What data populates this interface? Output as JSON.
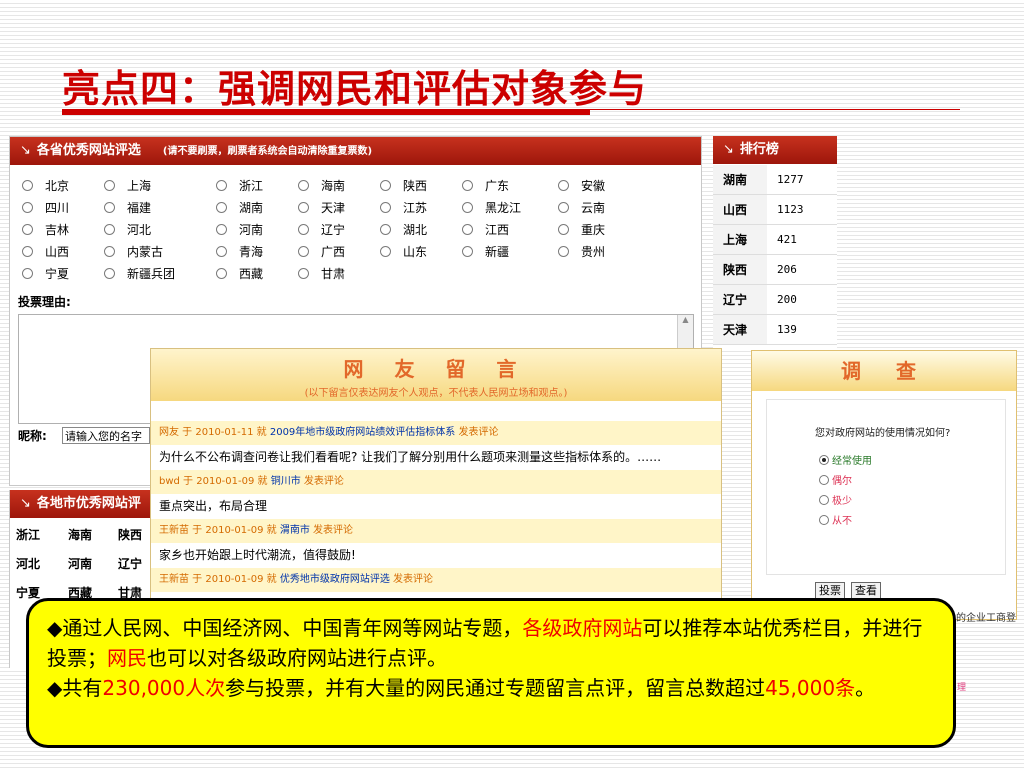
{
  "slide": {
    "title": "亮点四：强调网民和评估对象参与"
  },
  "vote_panel": {
    "header": "各省优秀网站评选",
    "header_note": "(请不要刷票，刷票者系统会自动清除重复票数)",
    "provinces": [
      "北京",
      "上海",
      "浙江",
      "海南",
      "陕西",
      "广东",
      "安徽",
      "四川",
      "福建",
      "湖南",
      "天津",
      "江苏",
      "黑龙江",
      "云南",
      "吉林",
      "河北",
      "河南",
      "辽宁",
      "湖北",
      "江西",
      "重庆",
      "山西",
      "内蒙古",
      "青海",
      "广西",
      "山东",
      "新疆",
      "贵州",
      "宁夏",
      "新疆兵团",
      "西藏",
      "甘肃"
    ],
    "reason_label": "投票理由:",
    "nickname_label": "昵称:",
    "nickname_value": "请输入您的名字"
  },
  "city_panel": {
    "header": "各地市优秀网站评",
    "cities": [
      "浙江",
      "海南",
      "陕西",
      "河北",
      "河南",
      "辽宁",
      "宁夏",
      "西藏",
      "甘肃"
    ]
  },
  "ranking": {
    "header": "排行榜",
    "rows": [
      {
        "name": "湖南",
        "value": "1277"
      },
      {
        "name": "山西",
        "value": "1123"
      },
      {
        "name": "上海",
        "value": "421"
      },
      {
        "name": "陕西",
        "value": "206"
      },
      {
        "name": "辽宁",
        "value": "200"
      },
      {
        "name": "天津",
        "value": "139"
      }
    ]
  },
  "comments": {
    "title": "网 友 留 言",
    "subtitle": "(以下留言仅表达网友个人观点，不代表人民网立场和观点。)",
    "items": [
      {
        "meta": "网友 于 2010-01-11 就",
        "topic": "2009年地市级政府网站绩效评估指标体系",
        "action": "发表评论",
        "text": "为什么不公布调查问卷让我们看看呢? 让我们了解分别用什么题项来测量这些指标体系的。……"
      },
      {
        "meta": "bwd 于 2010-01-09 就",
        "topic": "铜川市",
        "action": "发表评论",
        "text": "重点突出，布局合理"
      },
      {
        "meta": "王新苗 于 2010-01-09 就",
        "topic": "渭南市",
        "action": "发表评论",
        "text": "家乡也开始跟上时代潮流，值得鼓励!"
      },
      {
        "meta": "王新苗 于 2010-01-09 就",
        "topic": "优秀地市级政府网站评选",
        "action": "发表评论",
        "text": ""
      }
    ]
  },
  "survey": {
    "title": "调 查",
    "question": "您对政府网站的使用情况如何?",
    "options": [
      "经常使用",
      "偶尔",
      "极少",
      "从不"
    ],
    "selected_index": 0,
    "vote_button": "投票",
    "view_button": "查看",
    "tail_text": "的企业工商登",
    "tail_text2": "理"
  },
  "callout": {
    "line1_a": "◆通过人民网、中国经济网、中国青年网等网站专题，",
    "line1_red": "各级政府网站",
    "line1_b": "可以推荐本站优秀栏目，并进行投票；",
    "line1_red2": "网民",
    "line1_c": "也可以对各级政府网站进行点评。",
    "line2_a": "◆共有",
    "line2_red": "230,000人次",
    "line2_b": "参与投票，并有大量的网民通过专题留言点评，留言总数超过",
    "line2_red2": "45,000条",
    "line2_c": "。"
  },
  "colors": {
    "title_red": "#cc0000",
    "panel_header_red": "#b02414",
    "callout_yellow": "#ffff00",
    "highlight_red": "#ee0000",
    "comment_orange": "#e2682a"
  }
}
